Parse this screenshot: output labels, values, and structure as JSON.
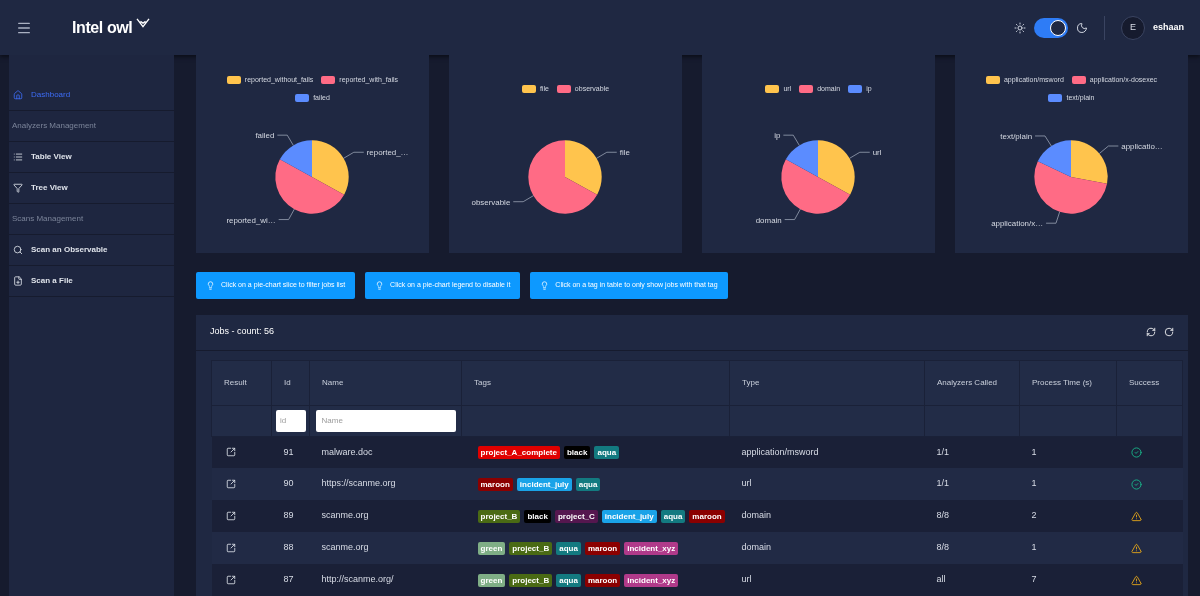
{
  "header": {
    "logo": "Intel owl",
    "dark_mode": true,
    "user": {
      "initial": "E",
      "name": "eshaan"
    }
  },
  "sidebar": {
    "items": [
      {
        "kind": "link",
        "label": "Dashboard",
        "selected": true
      },
      {
        "kind": "section",
        "label": "Analyzers Management"
      },
      {
        "kind": "link",
        "label": "Table View",
        "selected": false
      },
      {
        "kind": "link",
        "label": "Tree View",
        "selected": false
      },
      {
        "kind": "section",
        "label": "Scans Management"
      },
      {
        "kind": "link",
        "label": "Scan an Observable",
        "selected": false
      },
      {
        "kind": "link",
        "label": "Scan a File",
        "selected": false
      }
    ]
  },
  "charts": [
    {
      "legend": [
        {
          "label": "reported_without_fails",
          "color": "#ffc44d"
        },
        {
          "label": "reported_with_fails",
          "color": "#ff6b85"
        },
        {
          "label": "failed",
          "color": "#5b8cff"
        }
      ],
      "slice_labels": [
        "reported_…",
        "reported_wi…",
        "failed"
      ]
    },
    {
      "legend": [
        {
          "label": "file",
          "color": "#ffc44d"
        },
        {
          "label": "observable",
          "color": "#ff6b85"
        }
      ],
      "slice_labels": [
        "file",
        "observable"
      ]
    },
    {
      "legend": [
        {
          "label": "url",
          "color": "#ffc44d"
        },
        {
          "label": "domain",
          "color": "#ff6b85"
        },
        {
          "label": "ip",
          "color": "#5b8cff"
        }
      ],
      "slice_labels": [
        "url",
        "domain",
        "ip"
      ]
    },
    {
      "legend": [
        {
          "label": "application/msword",
          "color": "#ffc44d"
        },
        {
          "label": "application/x-dosexec",
          "color": "#ff6b85"
        },
        {
          "label": "text/plain",
          "color": "#5b8cff"
        }
      ],
      "slice_labels": [
        "applicatio…",
        "application/x…",
        "text/plain"
      ]
    }
  ],
  "hints": [
    "Click on a pie-chart slice to filter jobs list",
    "Click on a pie-chart legend to disable it",
    "Click on a tag in table to only show jobs with that tag"
  ],
  "jobs": {
    "title": "Jobs - count: 56",
    "columns": [
      "Result",
      "Id",
      "Name",
      "Tags",
      "Type",
      "Analyzers Called",
      "Process Time (s)",
      "Success"
    ],
    "filters": {
      "id_placeholder": "id",
      "name_placeholder": "Name"
    },
    "rows": [
      {
        "id": "91",
        "name": "malware.doc",
        "tags": [
          {
            "label": "project_A_complete",
            "color": "#e00000"
          },
          {
            "label": "black",
            "color": "#000000"
          },
          {
            "label": "aqua",
            "color": "#137a80"
          }
        ],
        "type": "application/msword",
        "analyzers_called": "1/1",
        "process_time": "1",
        "success": true
      },
      {
        "id": "90",
        "name": "https://scanme.org",
        "tags": [
          {
            "label": "maroon",
            "color": "#8b0000"
          },
          {
            "label": "incident_july",
            "color": "#1aa3e8"
          },
          {
            "label": "aqua",
            "color": "#137a80"
          }
        ],
        "type": "url",
        "analyzers_called": "1/1",
        "process_time": "1",
        "success": true
      },
      {
        "id": "89",
        "name": "scanme.org",
        "tags": [
          {
            "label": "project_B",
            "color": "#4a6a14"
          },
          {
            "label": "black",
            "color": "#000000"
          },
          {
            "label": "project_C",
            "color": "#55174f"
          },
          {
            "label": "incident_july",
            "color": "#1aa3e8"
          },
          {
            "label": "aqua",
            "color": "#137a80"
          },
          {
            "label": "maroon",
            "color": "#8b0000"
          }
        ],
        "type": "domain",
        "analyzers_called": "8/8",
        "process_time": "2",
        "success": false
      },
      {
        "id": "88",
        "name": "scanme.org",
        "tags": [
          {
            "label": "green",
            "color": "#7fae86"
          },
          {
            "label": "project_B",
            "color": "#4a6a14"
          },
          {
            "label": "aqua",
            "color": "#137a80"
          },
          {
            "label": "maroon",
            "color": "#8b0000"
          },
          {
            "label": "incident_xyz",
            "color": "#b03a8a"
          }
        ],
        "type": "domain",
        "analyzers_called": "8/8",
        "process_time": "1",
        "success": false
      },
      {
        "id": "87",
        "name": "http://scanme.org/",
        "tags": [
          {
            "label": "green",
            "color": "#7fae86"
          },
          {
            "label": "project_B",
            "color": "#4a6a14"
          },
          {
            "label": "aqua",
            "color": "#137a80"
          },
          {
            "label": "maroon",
            "color": "#8b0000"
          },
          {
            "label": "incident_xyz",
            "color": "#b03a8a"
          }
        ],
        "type": "url",
        "analyzers_called": "all",
        "process_time": "7",
        "success": false
      }
    ]
  }
}
